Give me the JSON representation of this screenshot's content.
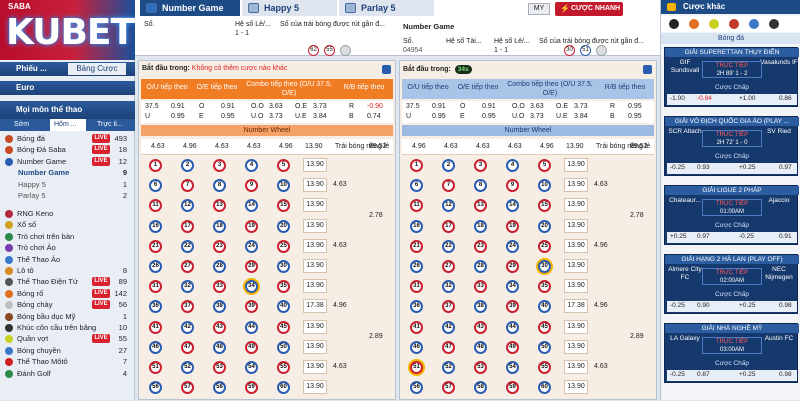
{
  "brand": {
    "logo_text": "KUBET",
    "small": "SABA"
  },
  "tabs": [
    {
      "label": "Number Game",
      "icon": "lottery-ball-icon"
    },
    {
      "label": "Happy 5",
      "icon": "dice-icon"
    },
    {
      "label": "Parlay 5",
      "icon": "ticket-icon"
    }
  ],
  "header": {
    "col1": "Số.",
    "col2": "Hệ số Lẻ/...",
    "col3": "Số của trái bóng được rút gần đ...",
    "sub1": "1 - 1",
    "balls": [
      "62",
      "55"
    ],
    "right_title": "Number Game",
    "right_col1": "Số.",
    "right_id": "04954",
    "right_col2": "Hệ số Tài...",
    "right_col3": "Hệ số Lẻ/...",
    "right_col4": "Số của trái bóng được rút gần đ...",
    "right_sub": "1 - 1",
    "right_balls": [
      "30",
      "51"
    ]
  },
  "topright": {
    "my_label": "MY",
    "quick_label": "CƯỢC NHANH"
  },
  "sidebar": {
    "head1": "Phiếu ...",
    "head1_btn": "Bảng Cược",
    "head2": "Euro",
    "head3": "Mọi môn thể thao",
    "tabs": [
      "Sớm",
      "Hôm ...",
      "Trực ti..."
    ],
    "items": [
      {
        "label": "Bóng đá",
        "live": "LIVE",
        "count": "493"
      },
      {
        "label": "Bóng Đá Saba",
        "live": "LIVE",
        "count": "18"
      },
      {
        "label": "Number Game",
        "live": "LIVE",
        "count": "12"
      },
      {
        "label": "Number Game",
        "live": "",
        "count": "9"
      },
      {
        "label": "Happy 5",
        "live": "",
        "count": "1"
      },
      {
        "label": "Parlay 5",
        "live": "",
        "count": "2"
      },
      {
        "label": "RNG Keno",
        "live": "",
        "count": ""
      },
      {
        "label": "Xổ số",
        "live": "",
        "count": ""
      },
      {
        "label": "Trò chơi trên bàn",
        "live": "",
        "count": ""
      },
      {
        "label": "Trò chơi Ảo",
        "live": "",
        "count": ""
      },
      {
        "label": "Thể Thao Ảo",
        "live": "",
        "count": ""
      },
      {
        "label": "Lô tô",
        "live": "",
        "count": "8"
      },
      {
        "label": "Thể Thao Điện Tử",
        "live": "LIVE",
        "count": "89"
      },
      {
        "label": "Bóng rổ",
        "live": "LIVE",
        "count": "142"
      },
      {
        "label": "Bóng chày",
        "live": "LIVE",
        "count": "56"
      },
      {
        "label": "Bóng bầu dục Mỹ",
        "live": "",
        "count": "1"
      },
      {
        "label": "Khúc côn cầu trên băng",
        "live": "",
        "count": "10"
      },
      {
        "label": "Quần vợt",
        "live": "LIVE",
        "count": "55"
      },
      {
        "label": "Bóng chuyền",
        "live": "",
        "count": "27"
      },
      {
        "label": "Thể Thao Môtô",
        "live": "",
        "count": "7"
      },
      {
        "label": "Đánh Golf",
        "live": "",
        "count": "4"
      }
    ]
  },
  "panel_left": {
    "start_label": "Bắt đầu trong:",
    "start_note": "Không có thêm cược nào khác",
    "heads": [
      "O/U tiếp theo",
      "O/E tiếp theo",
      "Combo tiếp theo (O/U 37.5, O/E)",
      "R/B tiếp theo"
    ],
    "row1": [
      "37.5",
      "0.91",
      "O",
      "0.91",
      "O.O",
      "3.63",
      "O.E",
      "3.73",
      "R",
      "-0.90"
    ],
    "row2": [
      "U",
      "0.95",
      "E",
      "0.95",
      "U.O",
      "3.73",
      "U.E",
      "3.84",
      "B",
      "0.74"
    ],
    "bar": "Number Wheel",
    "vals": [
      "4.63",
      "4.96",
      "4.63",
      "4.63",
      "4.96",
      "13.90",
      "Trái bóng riêng lẻ",
      "69.52"
    ],
    "row_odds": [
      "13.90",
      "13.90",
      "13.90",
      "13.90",
      "13.90",
      "13.90",
      "13.90",
      "17.38",
      "13.90",
      "13.90",
      "13.90",
      "13.90",
      "13.90",
      "13.90",
      "13.90",
      "13.90"
    ],
    "group_odds": [
      "4.63",
      "4.63",
      "4.96",
      "4.63"
    ],
    "big_odds": [
      "2.78",
      "2.89"
    ]
  },
  "panel_right": {
    "start_label": "Bắt đầu trong:",
    "timer": "34s",
    "heads": [
      "O/U tiếp theo",
      "O/E tiếp theo",
      "Combo tiếp theo (O/U 37.5, O/E)",
      "R/B tiếp theo"
    ],
    "row1": [
      "37.5",
      "0.91",
      "O",
      "0.91",
      "O.O",
      "3.63",
      "O.E",
      "3.73",
      "R",
      "0.95"
    ],
    "row2": [
      "U",
      "0.95",
      "E",
      "0.95",
      "U.O",
      "3.73",
      "U.E",
      "3.84",
      "B",
      "0.95"
    ],
    "bar": "Number Wheel",
    "vals": [
      "4.96",
      "4.63",
      "4.63",
      "4.63",
      "4.96",
      "13.90",
      "Trái bóng riêng lẻ",
      "69.52"
    ],
    "row_odds": [
      "13.90",
      "13.90",
      "13.90",
      "13.90",
      "13.90",
      "13.90",
      "13.90",
      "17.38",
      "13.90",
      "13.90",
      "13.90",
      "13.90",
      "13.90",
      "13.90",
      "17.38",
      "13.90"
    ],
    "group_odds": [
      "4.63",
      "4.96",
      "4.96",
      "4.63"
    ],
    "big_odds": [
      "2.78",
      "2.89"
    ]
  },
  "balls_left": [
    [
      "1",
      "2",
      "3",
      "4",
      "5"
    ],
    [
      "6",
      "7",
      "8",
      "9",
      "10"
    ],
    [
      "11",
      "12",
      "13",
      "14",
      "15"
    ],
    [
      "16",
      "17",
      "18",
      "19",
      "20"
    ],
    [
      "21",
      "22",
      "23",
      "24",
      "25"
    ],
    [
      "26",
      "27",
      "28",
      "29",
      "30"
    ],
    [
      "31",
      "32",
      "33",
      "34",
      "35"
    ],
    [
      "36",
      "37",
      "38",
      "39",
      "40"
    ],
    [
      "41",
      "42",
      "43",
      "44",
      "45"
    ],
    [
      "46",
      "47",
      "48",
      "49",
      "50"
    ],
    [
      "51",
      "52",
      "53",
      "54",
      "55"
    ],
    [
      "56",
      "57",
      "58",
      "59",
      "60"
    ]
  ],
  "balls_right": [
    [
      "1",
      "2",
      "3",
      "4",
      "5"
    ],
    [
      "6",
      "7",
      "8",
      "9",
      "10"
    ],
    [
      "11",
      "12",
      "13",
      "14",
      "15"
    ],
    [
      "16",
      "17",
      "18",
      "19",
      "20"
    ],
    [
      "21",
      "22",
      "23",
      "24",
      "25"
    ],
    [
      "26",
      "27",
      "28",
      "29",
      "30"
    ],
    [
      "31",
      "32",
      "33",
      "34",
      "35"
    ],
    [
      "36",
      "37",
      "38",
      "39",
      "40"
    ],
    [
      "41",
      "42",
      "43",
      "44",
      "45"
    ],
    [
      "46",
      "47",
      "48",
      "49",
      "50"
    ],
    [
      "51",
      "52",
      "53",
      "54",
      "55"
    ],
    [
      "56",
      "57",
      "58",
      "59",
      "60"
    ]
  ],
  "rightbar": {
    "title": "Cược khác",
    "sport": "Bóng đá",
    "cards": [
      {
        "league": "GIẢI SUPERETTAN THỤY ĐIỂN",
        "home": "GIF Sundsvall",
        "away": "Vasalunds IF",
        "status": "TRỰC TIẾP",
        "time": "2H 89'",
        "score": "1 - 2",
        "label": "Cược Chấp",
        "odds": [
          "-1.00",
          "-0.84",
          "+1.00",
          "0.86"
        ]
      },
      {
        "league": "GIẢI VÔ ĐỊCH QUỐC GIA ÁO (PLAY ...",
        "home": "SCR Altach",
        "away": "SV Ried",
        "status": "TRỰC TIẾP",
        "time": "2H 72'",
        "score": "1 - 0",
        "label": "Cược Chấp",
        "odds": [
          "-0.25",
          "0.93",
          "+0.25",
          "0.97"
        ]
      },
      {
        "league": "GIẢI LIGUE 2 PHÁP",
        "home": "Chateaur...",
        "away": "Ajaccio",
        "status": "TRỰC TIẾP",
        "time": "01:00AM",
        "score": "",
        "label": "Cược Chấp",
        "odds": [
          "+0.25",
          "0.97",
          "-0.25",
          "0.91"
        ]
      },
      {
        "league": "GIẢI HẠNG 2 HÀ LAN (PLAY OFF)",
        "home": "Almere City FC",
        "away": "NEC Nijmegen",
        "status": "TRỰC TIẾP",
        "time": "02:00AM",
        "score": "",
        "label": "Cược Chấp",
        "odds": [
          "-0.25",
          "0.90",
          "+0.25",
          "0.98"
        ]
      },
      {
        "league": "GIẢI NHÀ NGHỀ MỸ",
        "home": "LA Galaxy",
        "away": "Austin FC",
        "status": "TRỰC TIẾP",
        "time": "03:00AM",
        "score": "",
        "label": "Cược Chấp",
        "odds": [
          "-0.25",
          "0.87",
          "+0.25",
          "0.98"
        ]
      }
    ]
  },
  "colors": {
    "brand_red": "#c2192d",
    "nav_blue": "#1d4b86",
    "orange": "#f07c24",
    "ball_red": "#cc2030",
    "ball_blue": "#2a5db0"
  }
}
